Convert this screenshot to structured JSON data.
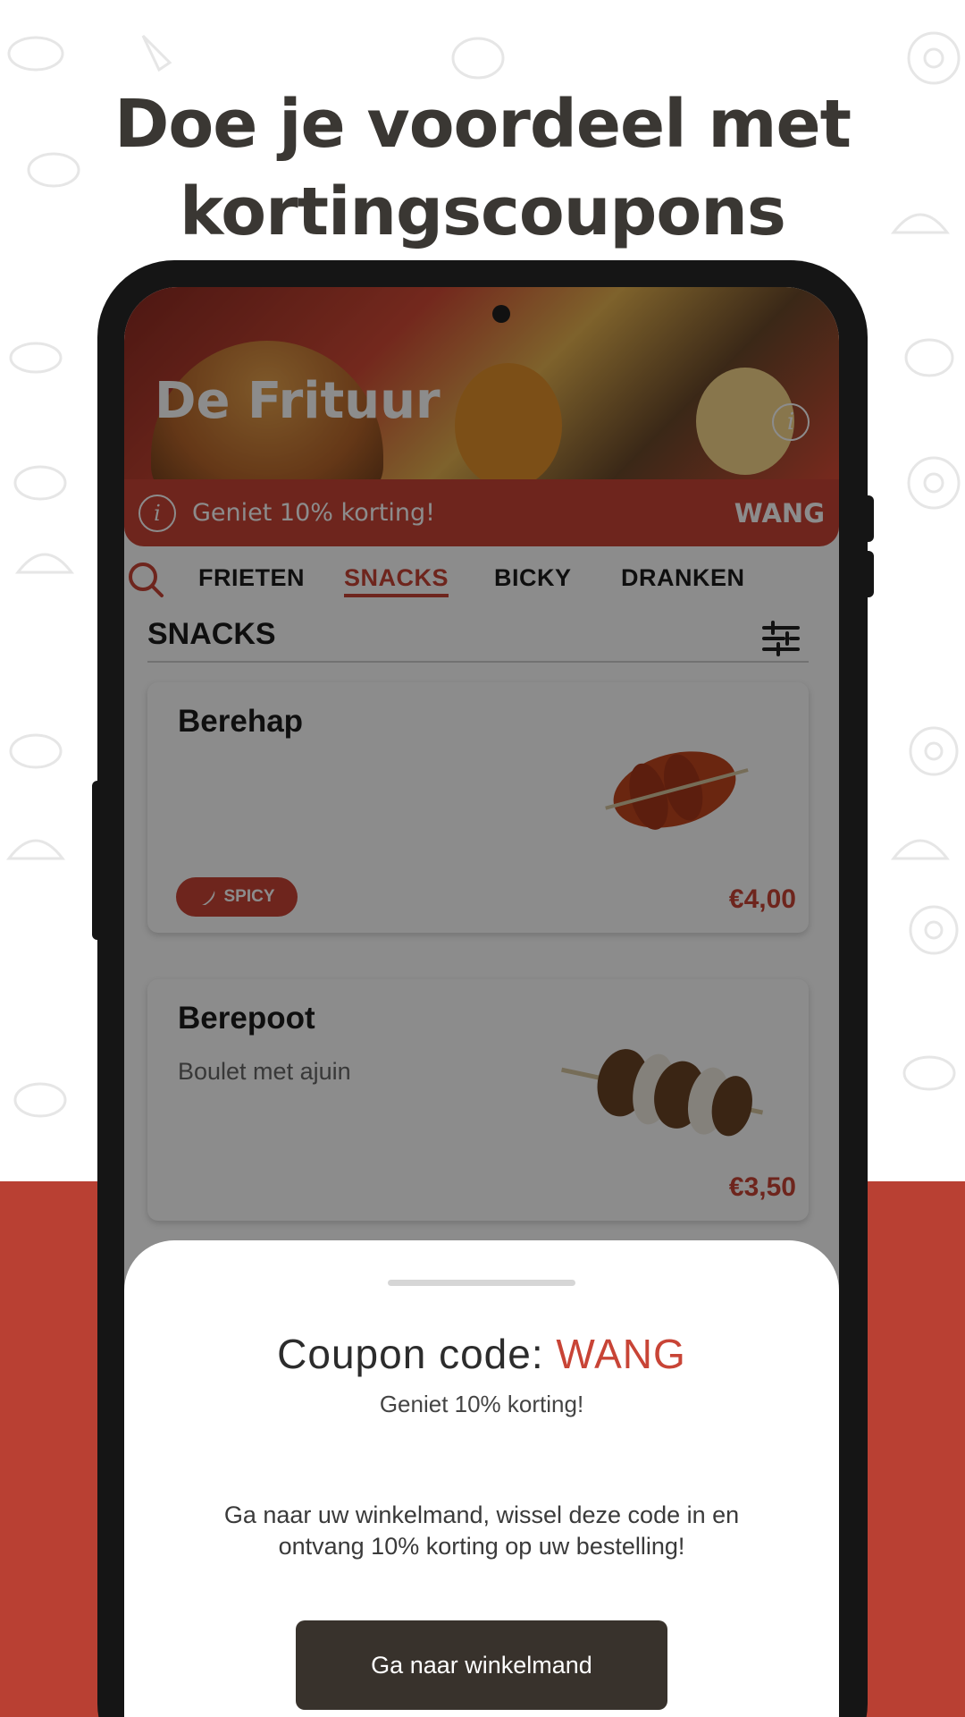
{
  "headline": {
    "line1": "Doe je voordeel met",
    "line2": "kortingscoupons"
  },
  "restaurant": {
    "name": "De Frituur"
  },
  "coupon_bar": {
    "message": "Geniet 10% korting!",
    "code": "WANG"
  },
  "tabs": [
    {
      "label": "FRIETEN",
      "active": false
    },
    {
      "label": "SNACKS",
      "active": true
    },
    {
      "label": "BICKY",
      "active": false
    },
    {
      "label": "DRANKEN",
      "active": false
    }
  ],
  "section": {
    "title": "SNACKS"
  },
  "products": [
    {
      "name": "Berehap",
      "description": "",
      "badge": "SPICY",
      "price": "€4,00"
    },
    {
      "name": "Berepoot",
      "description": "Boulet met ajuin",
      "badge": "",
      "price": "€3,50"
    }
  ],
  "sheet": {
    "title_prefix": "Coupon code:",
    "code": "WANG",
    "subtitle": "Geniet 10% korting!",
    "body_line1": "Ga naar uw winkelmand, wissel deze code in en",
    "body_line2": "ontvang 10% korting op uw bestelling!",
    "button_label": "Ga naar winkelmand"
  },
  "colors": {
    "accent": "#c84436",
    "background_red": "#b94033",
    "dark_button": "#38322c",
    "headline": "#3a3733"
  },
  "icons": {
    "search": "search-icon",
    "filter": "sliders-icon",
    "info": "info-icon",
    "spicy": "chili-icon"
  }
}
